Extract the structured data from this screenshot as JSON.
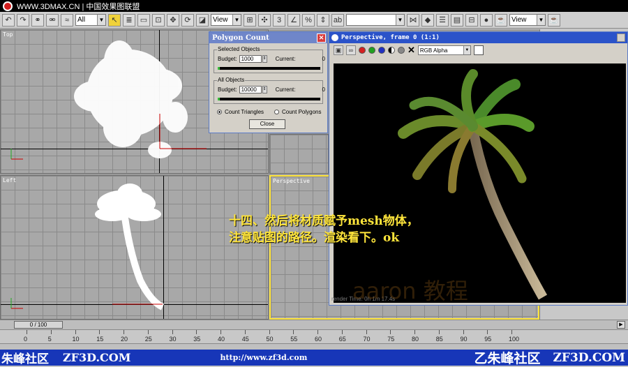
{
  "topbar": {
    "text": "WWW.3DMAX.CN | 中国效果图联盟"
  },
  "toolbar": {
    "select_filter": "All",
    "ref_coord": "View",
    "named_sel": "",
    "view_dropdown": "View"
  },
  "viewports": {
    "top": {
      "label": "Top"
    },
    "left": {
      "label": "Left"
    },
    "perspective": {
      "label": "Perspective"
    }
  },
  "polygon_count": {
    "title": "Polygon Count",
    "selected_group": "Selected Objects",
    "all_group": "All Objects",
    "budget_label": "Budget:",
    "current_label": "Current:",
    "selected_budget": "1000",
    "selected_current": "0",
    "all_budget": "10000",
    "all_current": "0",
    "count_triangles": "Count Triangles",
    "count_polygons": "Count Polygons",
    "close": "Close",
    "selected_fill": 0.02,
    "all_fill": 0.02,
    "mode": "triangles"
  },
  "render_window": {
    "title": "Perspective, frame 0 (1:1)",
    "channel": "RGB Alpha",
    "render_time": "render Time: 0h 1m 17.4s"
  },
  "caption": {
    "line1": "十四、然后将材质赋予mesh物体，",
    "line2": "注意贴图的路径。渲染看下。ok"
  },
  "watermark": "aaron 教程",
  "timeslider": {
    "frame_readout": "0 / 100",
    "ticks": [
      "0",
      "5",
      "10",
      "15",
      "20",
      "25",
      "30",
      "35",
      "40",
      "45",
      "50",
      "55",
      "60",
      "65",
      "70",
      "75",
      "80",
      "85",
      "90",
      "95",
      "100"
    ]
  },
  "banner": {
    "left_cn": "朱峰社区",
    "left_en": "ZF3D.COM",
    "url": "http://www.zf3d.com",
    "right_cn": "乙朱峰社区",
    "right_en": "ZF3D.COM"
  },
  "colors": {
    "caption": "#ffe53b",
    "banner": "#1736b8",
    "active_viewport": "#ffe53b"
  }
}
